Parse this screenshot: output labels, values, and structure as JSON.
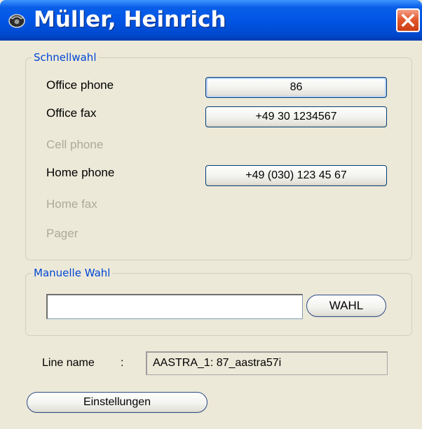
{
  "window": {
    "title": "Müller, Heinrich"
  },
  "speed_dial": {
    "legend": "Schnellwahl",
    "rows": [
      {
        "label": "Office phone",
        "value": "86"
      },
      {
        "label": "Office fax",
        "value": "+49 30 1234567"
      },
      {
        "label": "Cell phone"
      },
      {
        "label": "Home phone",
        "value": "+49 (030) 123 45 67"
      },
      {
        "label": "Home fax"
      },
      {
        "label": "Pager"
      }
    ]
  },
  "manual_dial": {
    "legend": "Manuelle Wahl",
    "input_value": "",
    "dial_label": "WAHL"
  },
  "line": {
    "label": "Line name",
    "separator": ":",
    "value": "AASTRA_1: 87_aastra57i"
  },
  "settings_label": "Einstellungen",
  "colors": {
    "title_bar": "#0055e5",
    "group_legend": "#0046d5",
    "disabled_text": "#acaa99",
    "close_button": "#e35a2e",
    "window_bg": "#ece9d8"
  },
  "icons": {
    "title": "phone-icon",
    "close": "close-icon"
  }
}
